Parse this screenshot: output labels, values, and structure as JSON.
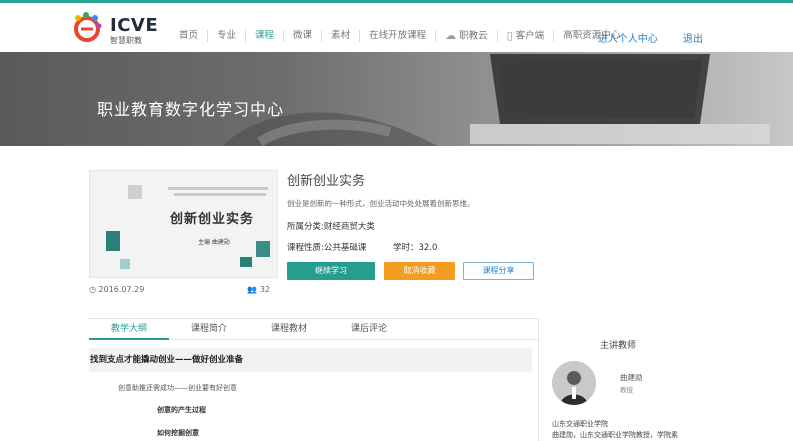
{
  "brand": {
    "logo_text": "ICVE",
    "logo_sub": "智慧职教"
  },
  "nav": {
    "items": [
      "首页",
      "专业",
      "课程",
      "微课",
      "素材",
      "在线开放课程",
      "职教云",
      "客户端",
      "高职资源中心"
    ],
    "active_index": 2,
    "enter_personal": "进入个人中心",
    "logout": "退出"
  },
  "banner": {
    "title": "职业教育数字化学习中心"
  },
  "course": {
    "name": "创新创业实务",
    "description": "创业是创新的一种形式，创业活动中处处展着创新思维。",
    "category": "所属分类:财经商贸大类",
    "type": "课程性质:公共基础课",
    "hours": "学时：32.0",
    "date": "2016.07.29",
    "views": "32",
    "cover_title": "创新创业实务",
    "cover_author": "主编  曲建勋"
  },
  "buttons": {
    "study": "继续学习",
    "cancel": "取消收藏",
    "share": "课程分享"
  },
  "tabs": [
    "教学大纲",
    "课程简介",
    "课程教材",
    "课后评论"
  ],
  "outline": {
    "chapter": "找到支点才能撬动创业——做好创业准备",
    "section": "创意助推还需成功——创业要有好创意",
    "items": [
      "创意的产生过程",
      "如何挖掘创意"
    ]
  },
  "teacher": {
    "heading": "主讲教师",
    "name": "曲建勋",
    "title": "教授",
    "school": "山东交通职业学院",
    "bio": "曲建勋，山东交通职业学院教授，学院素"
  },
  "colors": {
    "accent": "#279d8f",
    "orange": "#f39c1f",
    "link": "#2a7fc3"
  }
}
